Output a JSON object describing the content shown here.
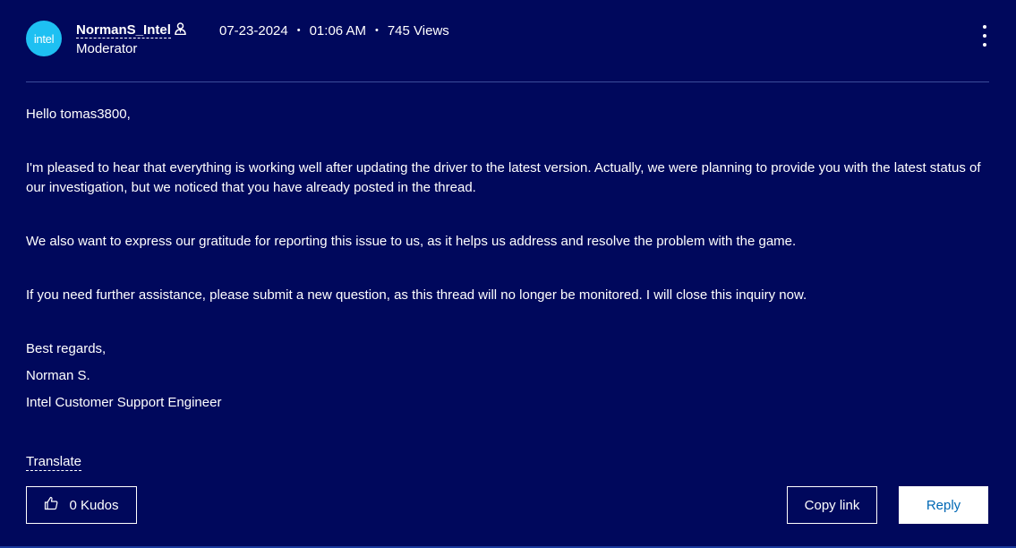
{
  "author": {
    "avatar_text": "intel",
    "name": "NormanS_Intel",
    "role": "Moderator",
    "badge_icon": "moderator-person-icon"
  },
  "meta": {
    "date": "07-23-2024",
    "time": "01:06 AM",
    "views": "745 Views",
    "separator": "•"
  },
  "message": {
    "greeting": "Hello tomas3800,",
    "paragraph1": "I'm pleased to hear that everything is working well after updating the driver to the latest version. Actually, we were planning to provide you with the latest status of our investigation, but we noticed that you have already posted in the thread.",
    "paragraph2": "We also want to express our gratitude for reporting this issue to us, as it helps us address and resolve the problem with the game.",
    "paragraph3": "If you need further assistance, please submit a new question, as this thread will no longer be monitored. I will close this inquiry now.",
    "closing": "Best regards,",
    "signature_name": "Norman S.",
    "signature_title": "Intel Customer Support Engineer"
  },
  "actions": {
    "translate": "Translate",
    "kudos": "0 Kudos",
    "copy_link": "Copy link",
    "reply": "Reply"
  },
  "colors": {
    "background": "#00085c",
    "avatar": "#1ec0f2",
    "reply_text": "#0068b5"
  }
}
